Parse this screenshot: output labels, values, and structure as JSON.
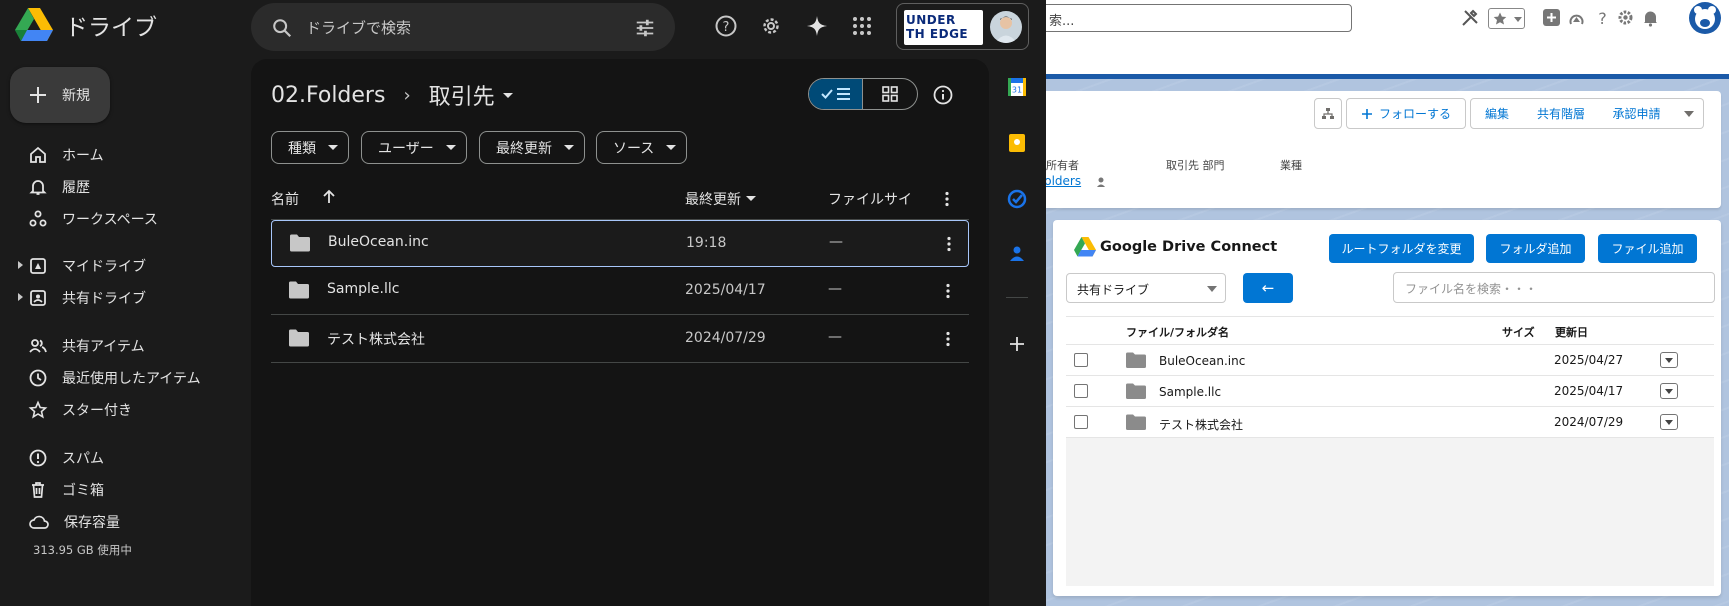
{
  "drive": {
    "app_title": "ドライブ",
    "search_placeholder": "ドライブで検索",
    "profile_logo_line1": "UNDER",
    "profile_logo_line2": "TH  EDGE",
    "new_button": "新規",
    "nav": [
      {
        "label": "ホーム"
      },
      {
        "label": "履歴"
      },
      {
        "label": "ワークスペース"
      },
      {
        "label": "マイドライブ"
      },
      {
        "label": "共有ドライブ"
      },
      {
        "label": "共有アイテム"
      },
      {
        "label": "最近使用したアイテム"
      },
      {
        "label": "スター付き"
      },
      {
        "label": "スパム"
      },
      {
        "label": "ゴミ箱"
      },
      {
        "label": "保存容量"
      }
    ],
    "storage_used": "313.95 GB 使用中",
    "breadcrumb": {
      "parent": "02.Folders",
      "current": "取引先"
    },
    "filters": [
      "種類",
      "ユーザー",
      "最終更新",
      "ソース"
    ],
    "columns": {
      "name": "名前",
      "modified": "最終更新",
      "size": "ファイルサイ"
    },
    "files": [
      {
        "name": "BuleOcean.inc",
        "modified": "19:18",
        "size": "—"
      },
      {
        "name": "Sample.llc",
        "modified": "2025/04/17",
        "size": "—"
      },
      {
        "name": "テスト株式会社",
        "modified": "2024/07/29",
        "size": "—"
      }
    ],
    "colors": {
      "bg": "#1b1b1b",
      "main": "#141414",
      "accent": "#a8c7fa",
      "toggle": "#004a77"
    }
  },
  "salesforce": {
    "search_text": "索...",
    "record_buttons": [
      "フォローする",
      "編集",
      "共有階層",
      "承認申請"
    ],
    "field_labels": {
      "owner": "所有者",
      "account_dept": "取引先 部門",
      "industry": "業種"
    },
    "owner_value": "folders",
    "gdc": {
      "title": "Google Drive Connect",
      "buttons": [
        "ルートフォルダを変更",
        "フォルダ追加",
        "ファイル追加"
      ],
      "drive_select": "共有ドライブ",
      "back_label": "←",
      "file_search_placeholder": "ファイル名を検索・・・",
      "columns": {
        "name": "ファイル/フォルダ名",
        "size": "サイズ",
        "modified": "更新日"
      },
      "rows": [
        {
          "name": "BuleOcean.inc",
          "modified": "2025/04/27"
        },
        {
          "name": "Sample.llc",
          "modified": "2025/04/17"
        },
        {
          "name": "テスト株式会社",
          "modified": "2024/07/29"
        }
      ]
    },
    "colors": {
      "brand": "#0176d3",
      "band": "#1b5aa8"
    }
  }
}
